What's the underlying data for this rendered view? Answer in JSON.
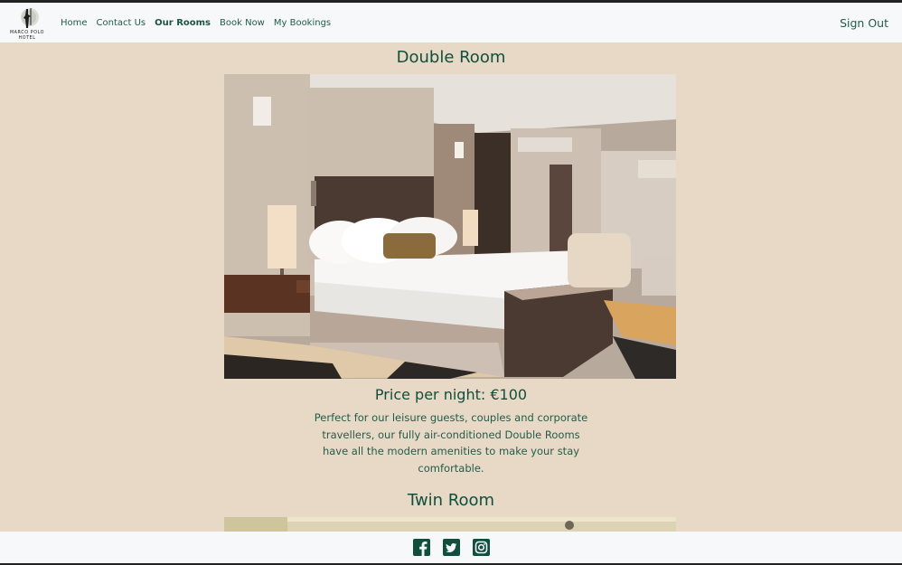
{
  "brand": {
    "logo_alt": "Marco Polo Hotel"
  },
  "nav": {
    "items": [
      {
        "label": "Home"
      },
      {
        "label": "Contact Us"
      },
      {
        "label": "Our Rooms",
        "active": true
      },
      {
        "label": "Book Now"
      },
      {
        "label": "My Bookings"
      }
    ],
    "signout_label": "Sign Out"
  },
  "rooms": [
    {
      "title": "Double Room",
      "price": "Price per night: €100",
      "description": "Perfect for our leisure guests, couples and corporate travellers, our fully air-conditioned Double Rooms have all the modern amenities to make your stay comfortable."
    },
    {
      "title": "Twin Room"
    }
  ],
  "footer": {
    "icons": [
      "facebook-icon",
      "twitter-icon",
      "instagram-icon"
    ]
  },
  "colors": {
    "page_background": "#e8d9c7",
    "brand_green": "#0f4f3c",
    "bar_background": "#f6f8fa"
  }
}
